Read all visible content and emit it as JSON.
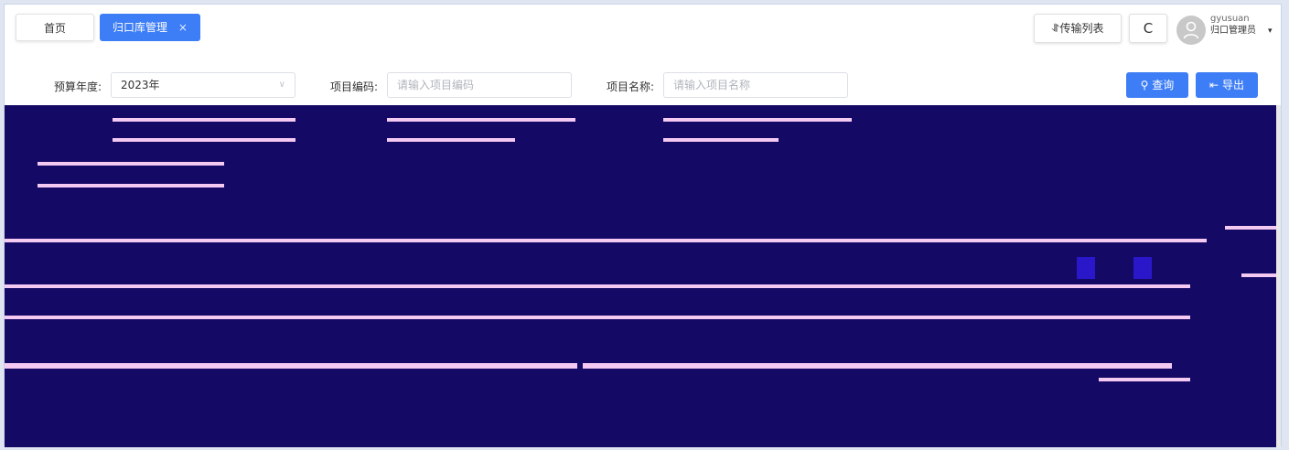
{
  "tabs": {
    "home": "首页",
    "active": "归口库管理",
    "close_glyph": "×"
  },
  "header": {
    "transfer_list": "⥯传输列表",
    "refresh_glyph": "C",
    "username": "gyusuan",
    "role": "归口管理员",
    "caret": "▾"
  },
  "filter": {
    "year_label": "预算年度:",
    "year_value": "2023年",
    "code_label": "项目编码:",
    "code_placeholder": "请输入项目编码",
    "name_label": "项目名称:",
    "name_placeholder": "请输入项目名称",
    "query_label": "查询",
    "export_label": "导出"
  },
  "icons": {
    "search": "search-icon",
    "export": "export-icon",
    "user": "user-icon",
    "refresh": "refresh-icon"
  },
  "colors": {
    "accent": "#3d7df5",
    "masked_background": "#140a66",
    "masked_text": "#f4c9f2"
  }
}
